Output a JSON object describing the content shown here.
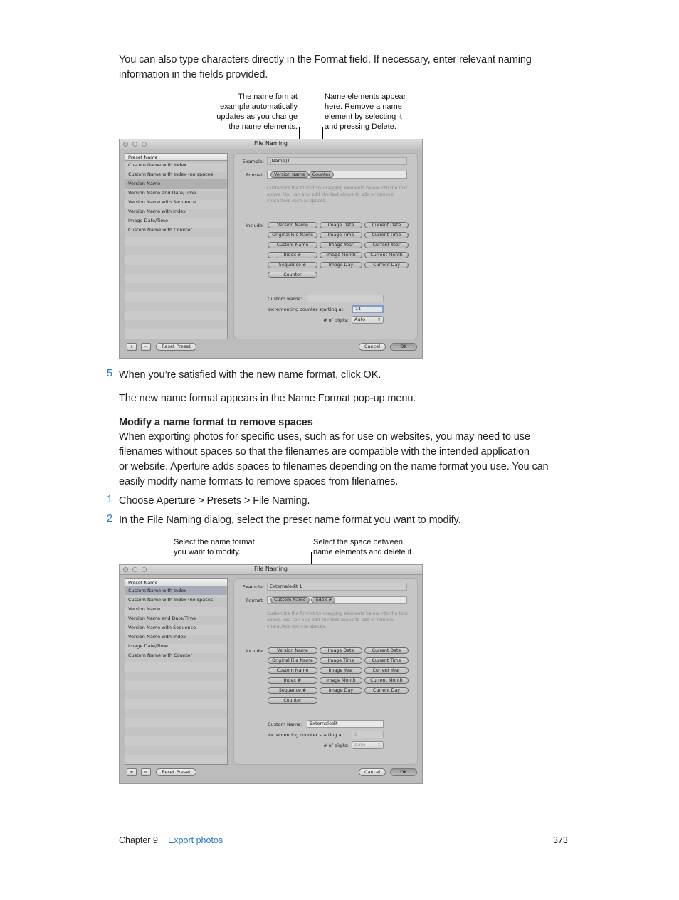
{
  "intro": {
    "line1": "You can also type characters directly in the Format field. If necessary, enter relevant naming",
    "line2": "information in the fields provided."
  },
  "callouts1": {
    "left": [
      "The name format",
      "example automatically",
      "updates as you change",
      "the name elements."
    ],
    "right": [
      "Name elements appear",
      "here. Remove a name",
      "element by selecting it",
      "and pressing Delete."
    ]
  },
  "callouts2": {
    "left": [
      "Select the name format",
      "you want to modify."
    ],
    "right": [
      "Select the space between",
      "name elements and delete it."
    ]
  },
  "dialog_common": {
    "title": "File Naming",
    "list_header": "Preset Name",
    "presets": [
      "Custom Name with Index",
      "Custom Name with Index (no spaces)",
      "Version Name",
      "Version Name and Date/Time",
      "Version Name with Sequence",
      "Version Name with Index",
      "Image Date/Time",
      "Custom Name with Counter"
    ],
    "example_label": "Example:",
    "format_label": "Format:",
    "hint": "Customize the format by dragging elements below into the text above. You can also edit the text above to add or remove characters such as spaces.",
    "include_label": "Include:",
    "include_tokens": [
      [
        "Version Name",
        "Image Date",
        "Current Date"
      ],
      [
        "Original File Name",
        "Image Time",
        "Current Time"
      ],
      [
        "Custom Name",
        "Image Year",
        "Current Year"
      ],
      [
        "Index #",
        "Image Month",
        "Current Month"
      ],
      [
        "Sequence #",
        "Image Day",
        "Current Day"
      ],
      [
        "Counter"
      ]
    ],
    "custom_name_label": "Custom Name:",
    "counter_label": "Incrementing counter starting at:",
    "digits_label": "# of digits:",
    "add_button": "+",
    "remove_button": "−",
    "reset_button": "Reset Preset",
    "cancel_button": "Cancel",
    "ok_button": "OK"
  },
  "dialog1": {
    "selected_preset": "Version Name",
    "example_value": "[Name]1",
    "format_tokens": [
      "Version Name",
      "Counter"
    ],
    "custom_name_value": "",
    "counter_value": "11",
    "digits_value": "Auto"
  },
  "dialog2": {
    "selected_preset": "Custom Name with Index",
    "example_value": "Externaledit 1",
    "format_tokens": [
      "Custom Name",
      "Index #"
    ],
    "custom_name_value": "Externaledit",
    "counter_value": "2",
    "digits_value": "Auto"
  },
  "steps": {
    "s5_num": "5",
    "s5_text": "When you’re satisfied with the new name format, click OK.",
    "s5_result": "The new name format appears in the Name Format pop-up menu.",
    "section_heading": "Modify a name format to remove spaces",
    "section_body": [
      "When exporting photos for specific uses, such as for use on websites, you may need to use",
      "filenames without spaces so that the filenames are compatible with the intended application",
      "or website. Aperture adds spaces to filenames depending on the name format you use. You can",
      "easily modify name formats to remove spaces from filenames."
    ],
    "s1_num": "1",
    "s1_text": "Choose Aperture > Presets > File Naming.",
    "s2_num": "2",
    "s2_text": "In the File Naming dialog, select the preset name format you want to modify."
  },
  "footer": {
    "chapter": "Chapter 9",
    "chapter_title": "Export photos",
    "page_number": "373"
  },
  "colors": {
    "accent": "#2a7ac0"
  }
}
